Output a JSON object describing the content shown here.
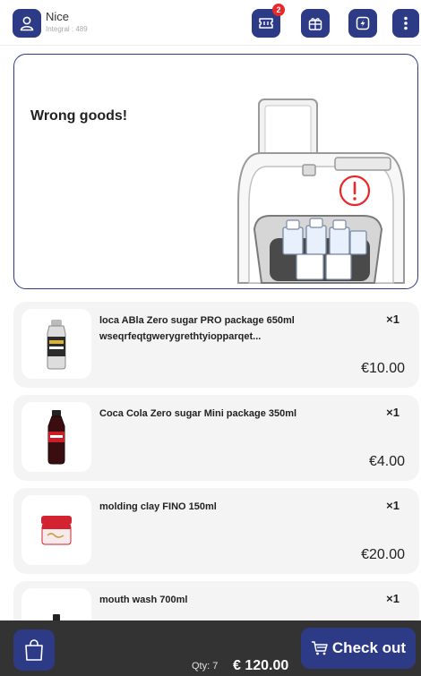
{
  "header": {
    "user_name": "Nice",
    "integral_text": "Integral : 489",
    "notification_count": "2",
    "icons": [
      "user-icon",
      "ticket-icon",
      "gift-icon",
      "flash-icon",
      "more-vertical-icon"
    ]
  },
  "alert": {
    "title": "Wrong goods!",
    "icon": "exclamation-circle-icon",
    "accent_color": "#e8282b"
  },
  "cart": {
    "items": [
      {
        "name": "loca ABla Zero sugar PRO package 650ml wseqrfeqtgwerygrethtyiopparqet...",
        "qty": "×1",
        "price": "€10.00",
        "image": "can-image"
      },
      {
        "name": "Coca Cola Zero sugar Mini package 350ml",
        "qty": "×1",
        "price": "€4.00",
        "image": "bottle-image"
      },
      {
        "name": "molding clay FINO 150ml",
        "qty": "×1",
        "price": "€20.00",
        "image": "jar-image"
      },
      {
        "name": "mouth wash 700ml",
        "qty": "×1",
        "price": "",
        "image": "mouthwash-image"
      }
    ]
  },
  "footer": {
    "qty_text": "Qty: 7",
    "total": "€ 120.00",
    "checkout_label": "Check out"
  },
  "colors": {
    "brand": "#2d3a86",
    "footer_bg": "#333333",
    "badge": "#e8282b"
  }
}
